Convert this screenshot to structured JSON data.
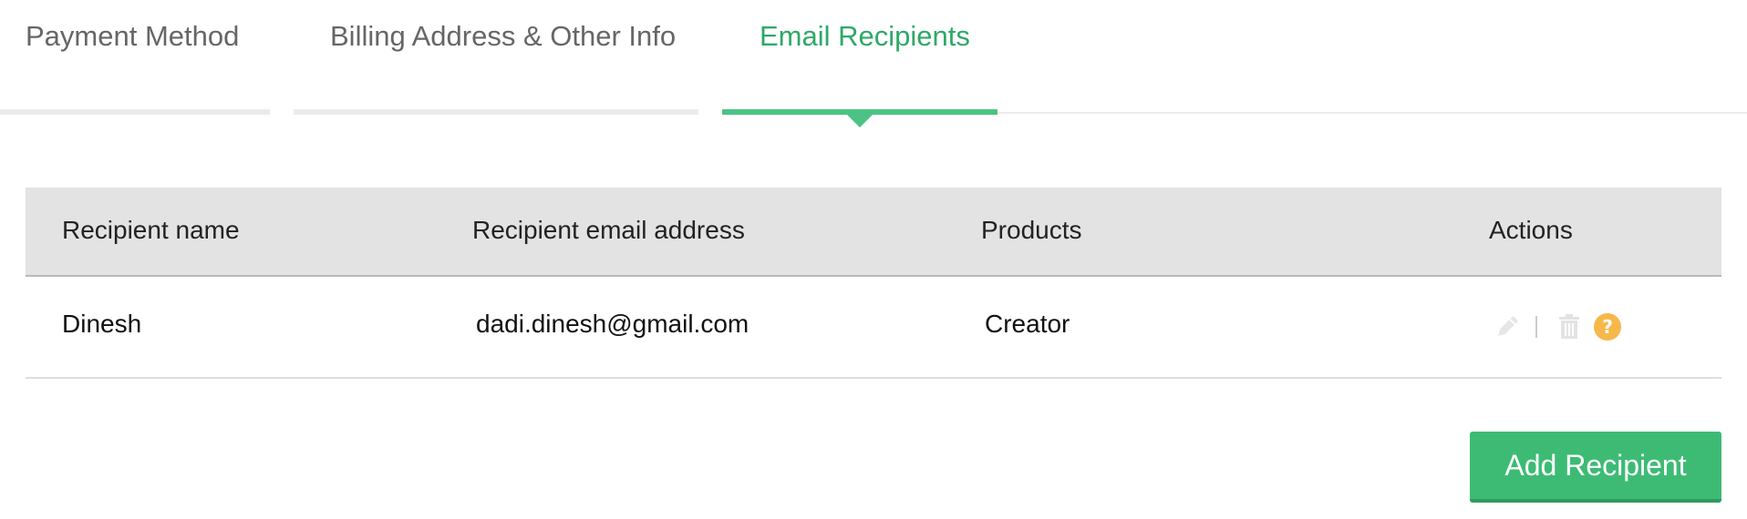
{
  "tabs": [
    {
      "label": "Payment Method",
      "active": false
    },
    {
      "label": "Billing Address & Other Info",
      "active": false
    },
    {
      "label": "Email Recipients",
      "active": true
    }
  ],
  "table": {
    "headers": [
      "Recipient name",
      "Recipient email address",
      "Products",
      "Actions"
    ],
    "rows": [
      {
        "name": "Dinesh",
        "email": "dadi.dinesh@gmail.com",
        "products": "Creator"
      }
    ],
    "action_icons": [
      "pencil-icon",
      "trash-icon",
      "help-icon"
    ],
    "help_glyph": "?"
  },
  "add_button": {
    "label": "Add Recipient"
  },
  "colors": {
    "accent": "#3dbb74",
    "active_tab_text": "#2fa867",
    "inactive_tab_text": "#666666",
    "header_bg": "#e3e3e3",
    "help_icon": "#f7b84b"
  }
}
